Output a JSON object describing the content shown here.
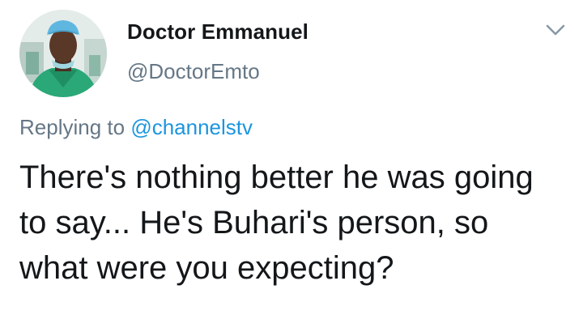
{
  "tweet": {
    "author": {
      "display_name": "Doctor Emmanuel",
      "handle": "@DoctorEmto",
      "avatar": "profile-photo"
    },
    "menu_icon": "chevron-down-icon",
    "reply": {
      "prefix": "Replying to",
      "handle": "@channelstv"
    },
    "text": "There's nothing better he was going to say... He's Buhari's person, so what were you expecting?"
  },
  "colors": {
    "primary_text": "#14171a",
    "secondary_text": "#657786",
    "link": "#1b95e0",
    "background": "#ffffff"
  }
}
